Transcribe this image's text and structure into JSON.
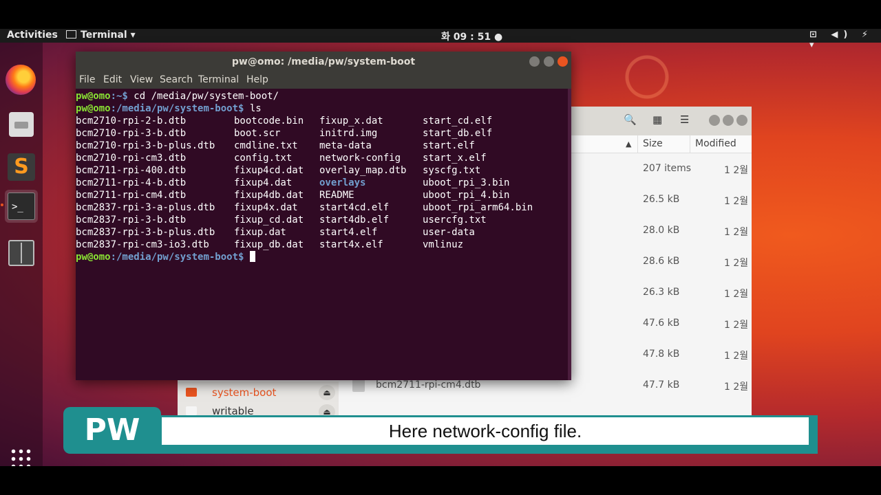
{
  "panel": {
    "activities": "Activities",
    "app_name": "Terminal ▾",
    "clock": "화 09 : 51 ●",
    "tray": "⊡ ◀) ⚡ ▾"
  },
  "dock": {
    "items": [
      "firefox-icon",
      "files-icon",
      "sublime-icon",
      "terminal-icon",
      "file-manager-icon"
    ],
    "terminal_glyph": ">_",
    "sublime_glyph": "S"
  },
  "terminal": {
    "title": "pw@omo: /media/pw/system-boot",
    "menu": [
      "File",
      "Edit",
      "View",
      "Search",
      "Terminal",
      "Help"
    ],
    "prompt_user": "pw@omo",
    "prompt_path_home": ":~$ ",
    "prompt_path_boot": ":/media/pw/system-boot$ ",
    "cmd1": "cd /media/pw/system-boot/",
    "cmd2": "ls",
    "files_col1": [
      "bcm2710-rpi-2-b.dtb",
      "bcm2710-rpi-3-b.dtb",
      "bcm2710-rpi-3-b-plus.dtb",
      "bcm2710-rpi-cm3.dtb",
      "bcm2711-rpi-400.dtb",
      "bcm2711-rpi-4-b.dtb",
      "bcm2711-rpi-cm4.dtb",
      "bcm2837-rpi-3-a-plus.dtb",
      "bcm2837-rpi-3-b.dtb",
      "bcm2837-rpi-3-b-plus.dtb",
      "bcm2837-rpi-cm3-io3.dtb"
    ],
    "files_col2": [
      "bootcode.bin",
      "boot.scr",
      "cmdline.txt",
      "config.txt",
      "fixup4cd.dat",
      "fixup4.dat",
      "fixup4db.dat",
      "fixup4x.dat",
      "fixup_cd.dat",
      "fixup.dat",
      "fixup_db.dat"
    ],
    "files_col3": [
      "fixup_x.dat",
      "initrd.img",
      "meta-data",
      "network-config",
      "overlay_map.dtb",
      "overlays",
      "README",
      "start4cd.elf",
      "start4db.elf",
      "start4.elf",
      "start4x.elf"
    ],
    "files_col4": [
      "start_cd.elf",
      "start_db.elf",
      "start.elf",
      "start_x.elf",
      "syscfg.txt",
      "uboot_rpi_3.bin",
      "uboot_rpi_4.bin",
      "uboot_rpi_arm64.bin",
      "usercfg.txt",
      "user-data",
      "vmlinuz"
    ],
    "dir_name": "overlays"
  },
  "filemanager": {
    "col_size": "Size",
    "col_modified": "Modified",
    "rows": [
      {
        "size": "207 items",
        "modified": "1 2월",
        "name": ""
      },
      {
        "size": "26.5 kB",
        "modified": "1 2월",
        "name": ""
      },
      {
        "size": "28.0 kB",
        "modified": "1 2월",
        "name": ""
      },
      {
        "size": "28.6 kB",
        "modified": "1 2월",
        "name": ""
      },
      {
        "size": "26.3 kB",
        "modified": "1 2월",
        "name": ""
      },
      {
        "size": "47.6 kB",
        "modified": "1 2월",
        "name": ""
      },
      {
        "size": "47.8 kB",
        "modified": "1 2월",
        "name": ""
      },
      {
        "size": "47.7 kB",
        "modified": "1 2월",
        "name": "bcm2711-rpi-cm4.dtb"
      }
    ],
    "sidebar": [
      "system-boot",
      "writable"
    ],
    "eject": "⏏"
  },
  "caption": {
    "logo": "PW",
    "text": "Here network-config file."
  },
  "colors": {
    "accent": "#e95420",
    "terminal_bg": "#300a24",
    "caption_teal": "#1f8f8f"
  }
}
